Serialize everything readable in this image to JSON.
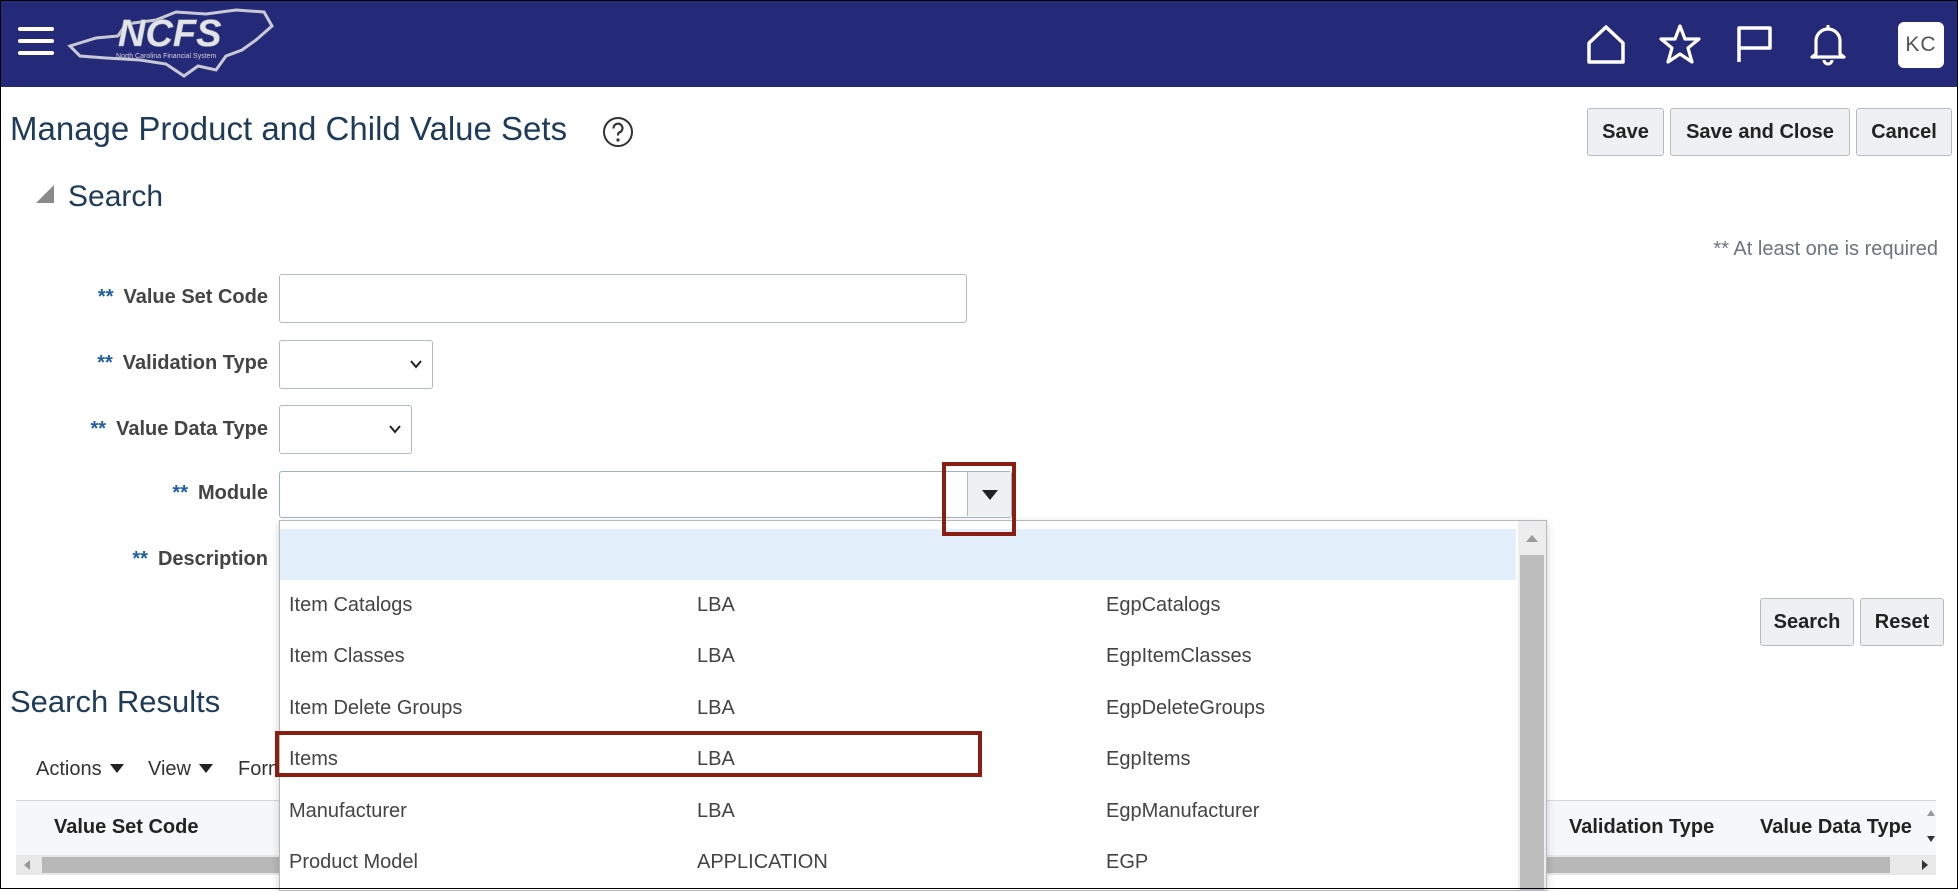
{
  "header": {
    "logo_text": "NCFS",
    "logo_subtext": "North Carolina Financial System",
    "user_initials": "KC"
  },
  "page": {
    "title": "Manage Product and Child Value Sets",
    "buttons": {
      "save": "Save",
      "save_and_close": "Save and Close",
      "cancel": "Cancel"
    }
  },
  "search": {
    "heading": "Search",
    "required_note": "** At least one is required",
    "required_marker": "**",
    "fields": {
      "value_set_code": {
        "label": "Value Set Code",
        "value": ""
      },
      "validation_type": {
        "label": "Validation Type",
        "value": ""
      },
      "value_data_type": {
        "label": "Value Data Type",
        "value": ""
      },
      "module": {
        "label": "Module",
        "value": ""
      },
      "description": {
        "label": "Description",
        "value": ""
      }
    },
    "search_button": "Search",
    "reset_button": "Reset"
  },
  "module_dropdown": {
    "rows": [
      {
        "name": "",
        "type": "",
        "code": ""
      },
      {
        "name": "Item Catalogs",
        "type": "LBA",
        "code": "EgpCatalogs"
      },
      {
        "name": "Item Classes",
        "type": "LBA",
        "code": "EgpItemClasses"
      },
      {
        "name": "Item Delete Groups",
        "type": "LBA",
        "code": "EgpDeleteGroups"
      },
      {
        "name": "Items",
        "type": "LBA",
        "code": "EgpItems"
      },
      {
        "name": "Manufacturer",
        "type": "LBA",
        "code": "EgpManufacturer"
      },
      {
        "name": "Product Model",
        "type": "APPLICATION",
        "code": "EGP"
      }
    ]
  },
  "results": {
    "heading": "Search Results",
    "toolbar": {
      "actions": "Actions",
      "view": "View",
      "format": "Form"
    },
    "columns": {
      "value_set_code": "Value Set Code",
      "validation_type": "Validation Type",
      "value_data_type": "Value Data Type"
    }
  },
  "colors": {
    "header_bg": "#252a78",
    "highlight": "#8b1e12",
    "selected_row": "#e4effc",
    "title": "#1f3b5a"
  }
}
